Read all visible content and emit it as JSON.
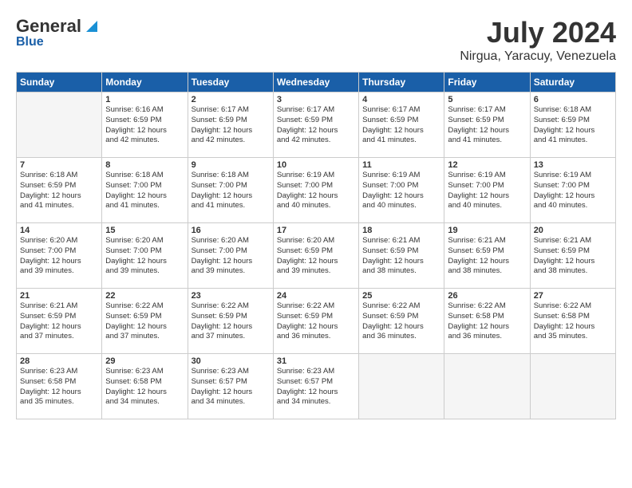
{
  "header": {
    "logo_general": "General",
    "logo_blue": "Blue",
    "month_title": "July 2024",
    "location": "Nirgua, Yaracuy, Venezuela"
  },
  "calendar": {
    "days_of_week": [
      "Sunday",
      "Monday",
      "Tuesday",
      "Wednesday",
      "Thursday",
      "Friday",
      "Saturday"
    ],
    "weeks": [
      [
        {
          "day": "",
          "info": ""
        },
        {
          "day": "1",
          "info": "Sunrise: 6:16 AM\nSunset: 6:59 PM\nDaylight: 12 hours\nand 42 minutes."
        },
        {
          "day": "2",
          "info": "Sunrise: 6:17 AM\nSunset: 6:59 PM\nDaylight: 12 hours\nand 42 minutes."
        },
        {
          "day": "3",
          "info": "Sunrise: 6:17 AM\nSunset: 6:59 PM\nDaylight: 12 hours\nand 42 minutes."
        },
        {
          "day": "4",
          "info": "Sunrise: 6:17 AM\nSunset: 6:59 PM\nDaylight: 12 hours\nand 41 minutes."
        },
        {
          "day": "5",
          "info": "Sunrise: 6:17 AM\nSunset: 6:59 PM\nDaylight: 12 hours\nand 41 minutes."
        },
        {
          "day": "6",
          "info": "Sunrise: 6:18 AM\nSunset: 6:59 PM\nDaylight: 12 hours\nand 41 minutes."
        }
      ],
      [
        {
          "day": "7",
          "info": "Sunrise: 6:18 AM\nSunset: 6:59 PM\nDaylight: 12 hours\nand 41 minutes."
        },
        {
          "day": "8",
          "info": "Sunrise: 6:18 AM\nSunset: 7:00 PM\nDaylight: 12 hours\nand 41 minutes."
        },
        {
          "day": "9",
          "info": "Sunrise: 6:18 AM\nSunset: 7:00 PM\nDaylight: 12 hours\nand 41 minutes."
        },
        {
          "day": "10",
          "info": "Sunrise: 6:19 AM\nSunset: 7:00 PM\nDaylight: 12 hours\nand 40 minutes."
        },
        {
          "day": "11",
          "info": "Sunrise: 6:19 AM\nSunset: 7:00 PM\nDaylight: 12 hours\nand 40 minutes."
        },
        {
          "day": "12",
          "info": "Sunrise: 6:19 AM\nSunset: 7:00 PM\nDaylight: 12 hours\nand 40 minutes."
        },
        {
          "day": "13",
          "info": "Sunrise: 6:19 AM\nSunset: 7:00 PM\nDaylight: 12 hours\nand 40 minutes."
        }
      ],
      [
        {
          "day": "14",
          "info": "Sunrise: 6:20 AM\nSunset: 7:00 PM\nDaylight: 12 hours\nand 39 minutes."
        },
        {
          "day": "15",
          "info": "Sunrise: 6:20 AM\nSunset: 7:00 PM\nDaylight: 12 hours\nand 39 minutes."
        },
        {
          "day": "16",
          "info": "Sunrise: 6:20 AM\nSunset: 7:00 PM\nDaylight: 12 hours\nand 39 minutes."
        },
        {
          "day": "17",
          "info": "Sunrise: 6:20 AM\nSunset: 6:59 PM\nDaylight: 12 hours\nand 39 minutes."
        },
        {
          "day": "18",
          "info": "Sunrise: 6:21 AM\nSunset: 6:59 PM\nDaylight: 12 hours\nand 38 minutes."
        },
        {
          "day": "19",
          "info": "Sunrise: 6:21 AM\nSunset: 6:59 PM\nDaylight: 12 hours\nand 38 minutes."
        },
        {
          "day": "20",
          "info": "Sunrise: 6:21 AM\nSunset: 6:59 PM\nDaylight: 12 hours\nand 38 minutes."
        }
      ],
      [
        {
          "day": "21",
          "info": "Sunrise: 6:21 AM\nSunset: 6:59 PM\nDaylight: 12 hours\nand 37 minutes."
        },
        {
          "day": "22",
          "info": "Sunrise: 6:22 AM\nSunset: 6:59 PM\nDaylight: 12 hours\nand 37 minutes."
        },
        {
          "day": "23",
          "info": "Sunrise: 6:22 AM\nSunset: 6:59 PM\nDaylight: 12 hours\nand 37 minutes."
        },
        {
          "day": "24",
          "info": "Sunrise: 6:22 AM\nSunset: 6:59 PM\nDaylight: 12 hours\nand 36 minutes."
        },
        {
          "day": "25",
          "info": "Sunrise: 6:22 AM\nSunset: 6:59 PM\nDaylight: 12 hours\nand 36 minutes."
        },
        {
          "day": "26",
          "info": "Sunrise: 6:22 AM\nSunset: 6:58 PM\nDaylight: 12 hours\nand 36 minutes."
        },
        {
          "day": "27",
          "info": "Sunrise: 6:22 AM\nSunset: 6:58 PM\nDaylight: 12 hours\nand 35 minutes."
        }
      ],
      [
        {
          "day": "28",
          "info": "Sunrise: 6:23 AM\nSunset: 6:58 PM\nDaylight: 12 hours\nand 35 minutes."
        },
        {
          "day": "29",
          "info": "Sunrise: 6:23 AM\nSunset: 6:58 PM\nDaylight: 12 hours\nand 34 minutes."
        },
        {
          "day": "30",
          "info": "Sunrise: 6:23 AM\nSunset: 6:57 PM\nDaylight: 12 hours\nand 34 minutes."
        },
        {
          "day": "31",
          "info": "Sunrise: 6:23 AM\nSunset: 6:57 PM\nDaylight: 12 hours\nand 34 minutes."
        },
        {
          "day": "",
          "info": ""
        },
        {
          "day": "",
          "info": ""
        },
        {
          "day": "",
          "info": ""
        }
      ]
    ]
  }
}
